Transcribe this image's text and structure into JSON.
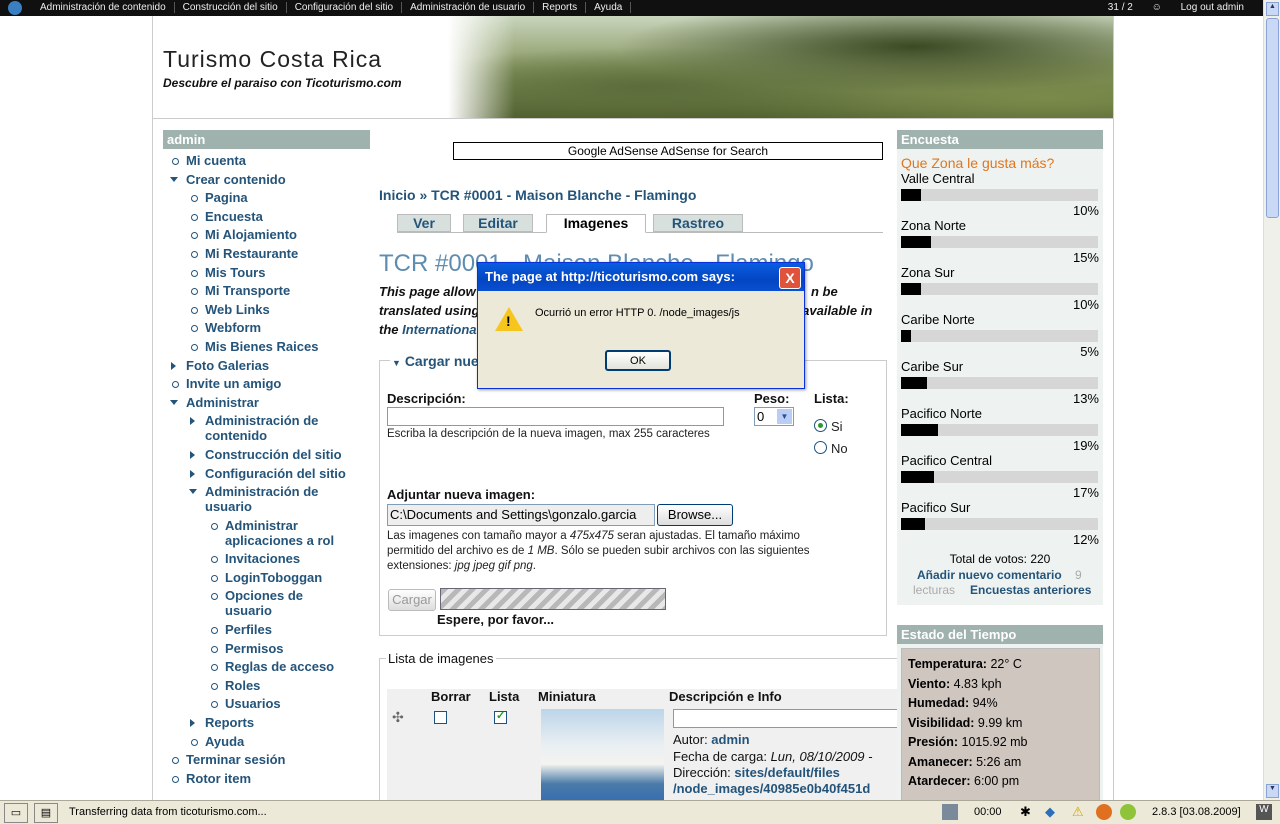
{
  "admin_bar": {
    "items": [
      "Administración de contenido",
      "Construcción del sitio",
      "Configuración del sitio",
      "Administración de usuario",
      "Reports",
      "Ayuda"
    ],
    "counter": "31 / 2",
    "logout": "Log out admin"
  },
  "site": {
    "name": "Turismo Costa Rica",
    "slogan": "Descubre el paraiso con Ticoturismo.com"
  },
  "left_block": {
    "title": "admin",
    "items": [
      {
        "label": "Mi cuenta"
      },
      {
        "label": "Crear contenido"
      },
      {
        "label": "Pagina"
      },
      {
        "label": "Encuesta"
      },
      {
        "label": "Mi Alojamiento"
      },
      {
        "label": "Mi Restaurante"
      },
      {
        "label": "Mis Tours"
      },
      {
        "label": "Mi Transporte"
      },
      {
        "label": "Web Links"
      },
      {
        "label": "Webform"
      },
      {
        "label": "Mis Bienes Raices"
      },
      {
        "label": "Foto Galerias"
      },
      {
        "label": "Invite un amigo"
      },
      {
        "label": "Administrar"
      },
      {
        "label": "Administración de contenido"
      },
      {
        "label": "Construcción del sitio"
      },
      {
        "label": "Configuración del sitio"
      },
      {
        "label": "Administración de usuario"
      },
      {
        "label": "Administrar aplicaciones a rol"
      },
      {
        "label": "Invitaciones"
      },
      {
        "label": "LoginToboggan"
      },
      {
        "label": "Opciones de usuario"
      },
      {
        "label": "Perfiles"
      },
      {
        "label": "Permisos"
      },
      {
        "label": "Reglas de acceso"
      },
      {
        "label": "Roles"
      },
      {
        "label": "Usuarios"
      },
      {
        "label": "Reports"
      },
      {
        "label": "Ayuda"
      },
      {
        "label": "Terminar sesión"
      },
      {
        "label": "Rotor item"
      }
    ]
  },
  "content": {
    "adsense": "Google AdSense AdSense for Search",
    "breadcrumb": "Inicio » TCR #0001 - Maison Blanche - Flamingo",
    "tabs": [
      "Ver",
      "Editar",
      "Imagenes",
      "Rastreo"
    ],
    "title": "TCR #0001 - Maison Blanche - Flamingo",
    "intro_1": "This page allow",
    "intro_1b": "n be",
    "intro_2": "translated using",
    "intro_2b": "e (available in",
    "intro_3": "the ",
    "intro_3_link": "International",
    "upload": {
      "legend": "Cargar nue",
      "desc_label": "Descripción:",
      "desc_value": "",
      "desc_help": "Escriba la descripción de la nueva imagen, max 255 caracteres",
      "weight_label": "Peso:",
      "weight_value": "0",
      "list_label": "Lista:",
      "opt_si": "Si",
      "opt_no": "No",
      "attach_label": "Adjuntar nueva imagen:",
      "file_value": "C:\\Documents and Settings\\gonzalo.garcia",
      "browse": "Browse...",
      "help_a": "Las imagenes con tamaño mayor a ",
      "help_dims": "475x475",
      "help_b": " seran ajustadas. El tamaño máximo",
      "help_c": "permitido del archivo es de ",
      "help_size": "1 MB",
      "help_d": ". Sólo se pueden subir archivos con las siguientes",
      "help_e": "extensiones: ",
      "help_ext": "jpg jpeg gif png",
      "help_f": ".",
      "upload_button": "Cargar",
      "wait": "Espere, por favor..."
    },
    "images": {
      "legend": "Lista de imagenes",
      "col_delete": "Borrar",
      "col_list": "Lista",
      "col_thumb": "Miniatura",
      "col_desc": "Descripción e Info",
      "author_label": "Autor: ",
      "author": "admin",
      "date_label": "Fecha de carga: ",
      "date": "Lun, 08/10/2009 -",
      "path_label": "Dirección: ",
      "path_1": "sites/default/files",
      "path_2": "/node_images/40985e0b40f451d"
    }
  },
  "poll": {
    "block_title": "Encuesta",
    "question": "Que Zona le gusta más?",
    "choices": [
      {
        "label": "Valle Central",
        "percent": 10,
        "percent_label": "10%"
      },
      {
        "label": "Zona Norte",
        "percent": 15,
        "percent_label": "15%"
      },
      {
        "label": "Zona Sur",
        "percent": 10,
        "percent_label": "10%"
      },
      {
        "label": "Caribe Norte",
        "percent": 5,
        "percent_label": "5%"
      },
      {
        "label": "Caribe Sur",
        "percent": 13,
        "percent_label": "13%"
      },
      {
        "label": "Pacifico Norte",
        "percent": 19,
        "percent_label": "19%"
      },
      {
        "label": "Pacifico Central",
        "percent": 17,
        "percent_label": "17%"
      },
      {
        "label": "Pacifico Sur",
        "percent": 12,
        "percent_label": "12%"
      }
    ],
    "total": "Total de votos: 220",
    "add_comment": "Añadir nuevo comentario",
    "reads_count": "9",
    "reads_label": "lecturas",
    "older": "Encuestas anteriores"
  },
  "weather": {
    "block_title": "Estado del Tiempo",
    "rows": [
      {
        "label": "Temperatura:",
        "value": " 22° C"
      },
      {
        "label": "Viento:",
        "value": " 4.83 kph"
      },
      {
        "label": "Humedad:",
        "value": " 94%"
      },
      {
        "label": "Visibilidad:",
        "value": " 9.99 km"
      },
      {
        "label": "Presión:",
        "value": " 1015.92 mb"
      },
      {
        "label": "Amanecer:",
        "value": " 5:26 am"
      },
      {
        "label": "Atardecer:",
        "value": " 6:00 pm"
      }
    ]
  },
  "dialog": {
    "title": "The page at http://ticoturismo.com says:",
    "message": "Ocurrió un error HTTP 0. /node_images/js",
    "ok": "OK",
    "close": "X"
  },
  "statusbar": {
    "text": "Transferring data from ticoturismo.com...",
    "time": "00:00",
    "version": "2.8.3 [03.08.2009]"
  },
  "colors": {
    "link": "#24547a",
    "block_header": "#9fb2ae",
    "poll_question": "#e0761e",
    "dialog_title": "#0346c3"
  }
}
